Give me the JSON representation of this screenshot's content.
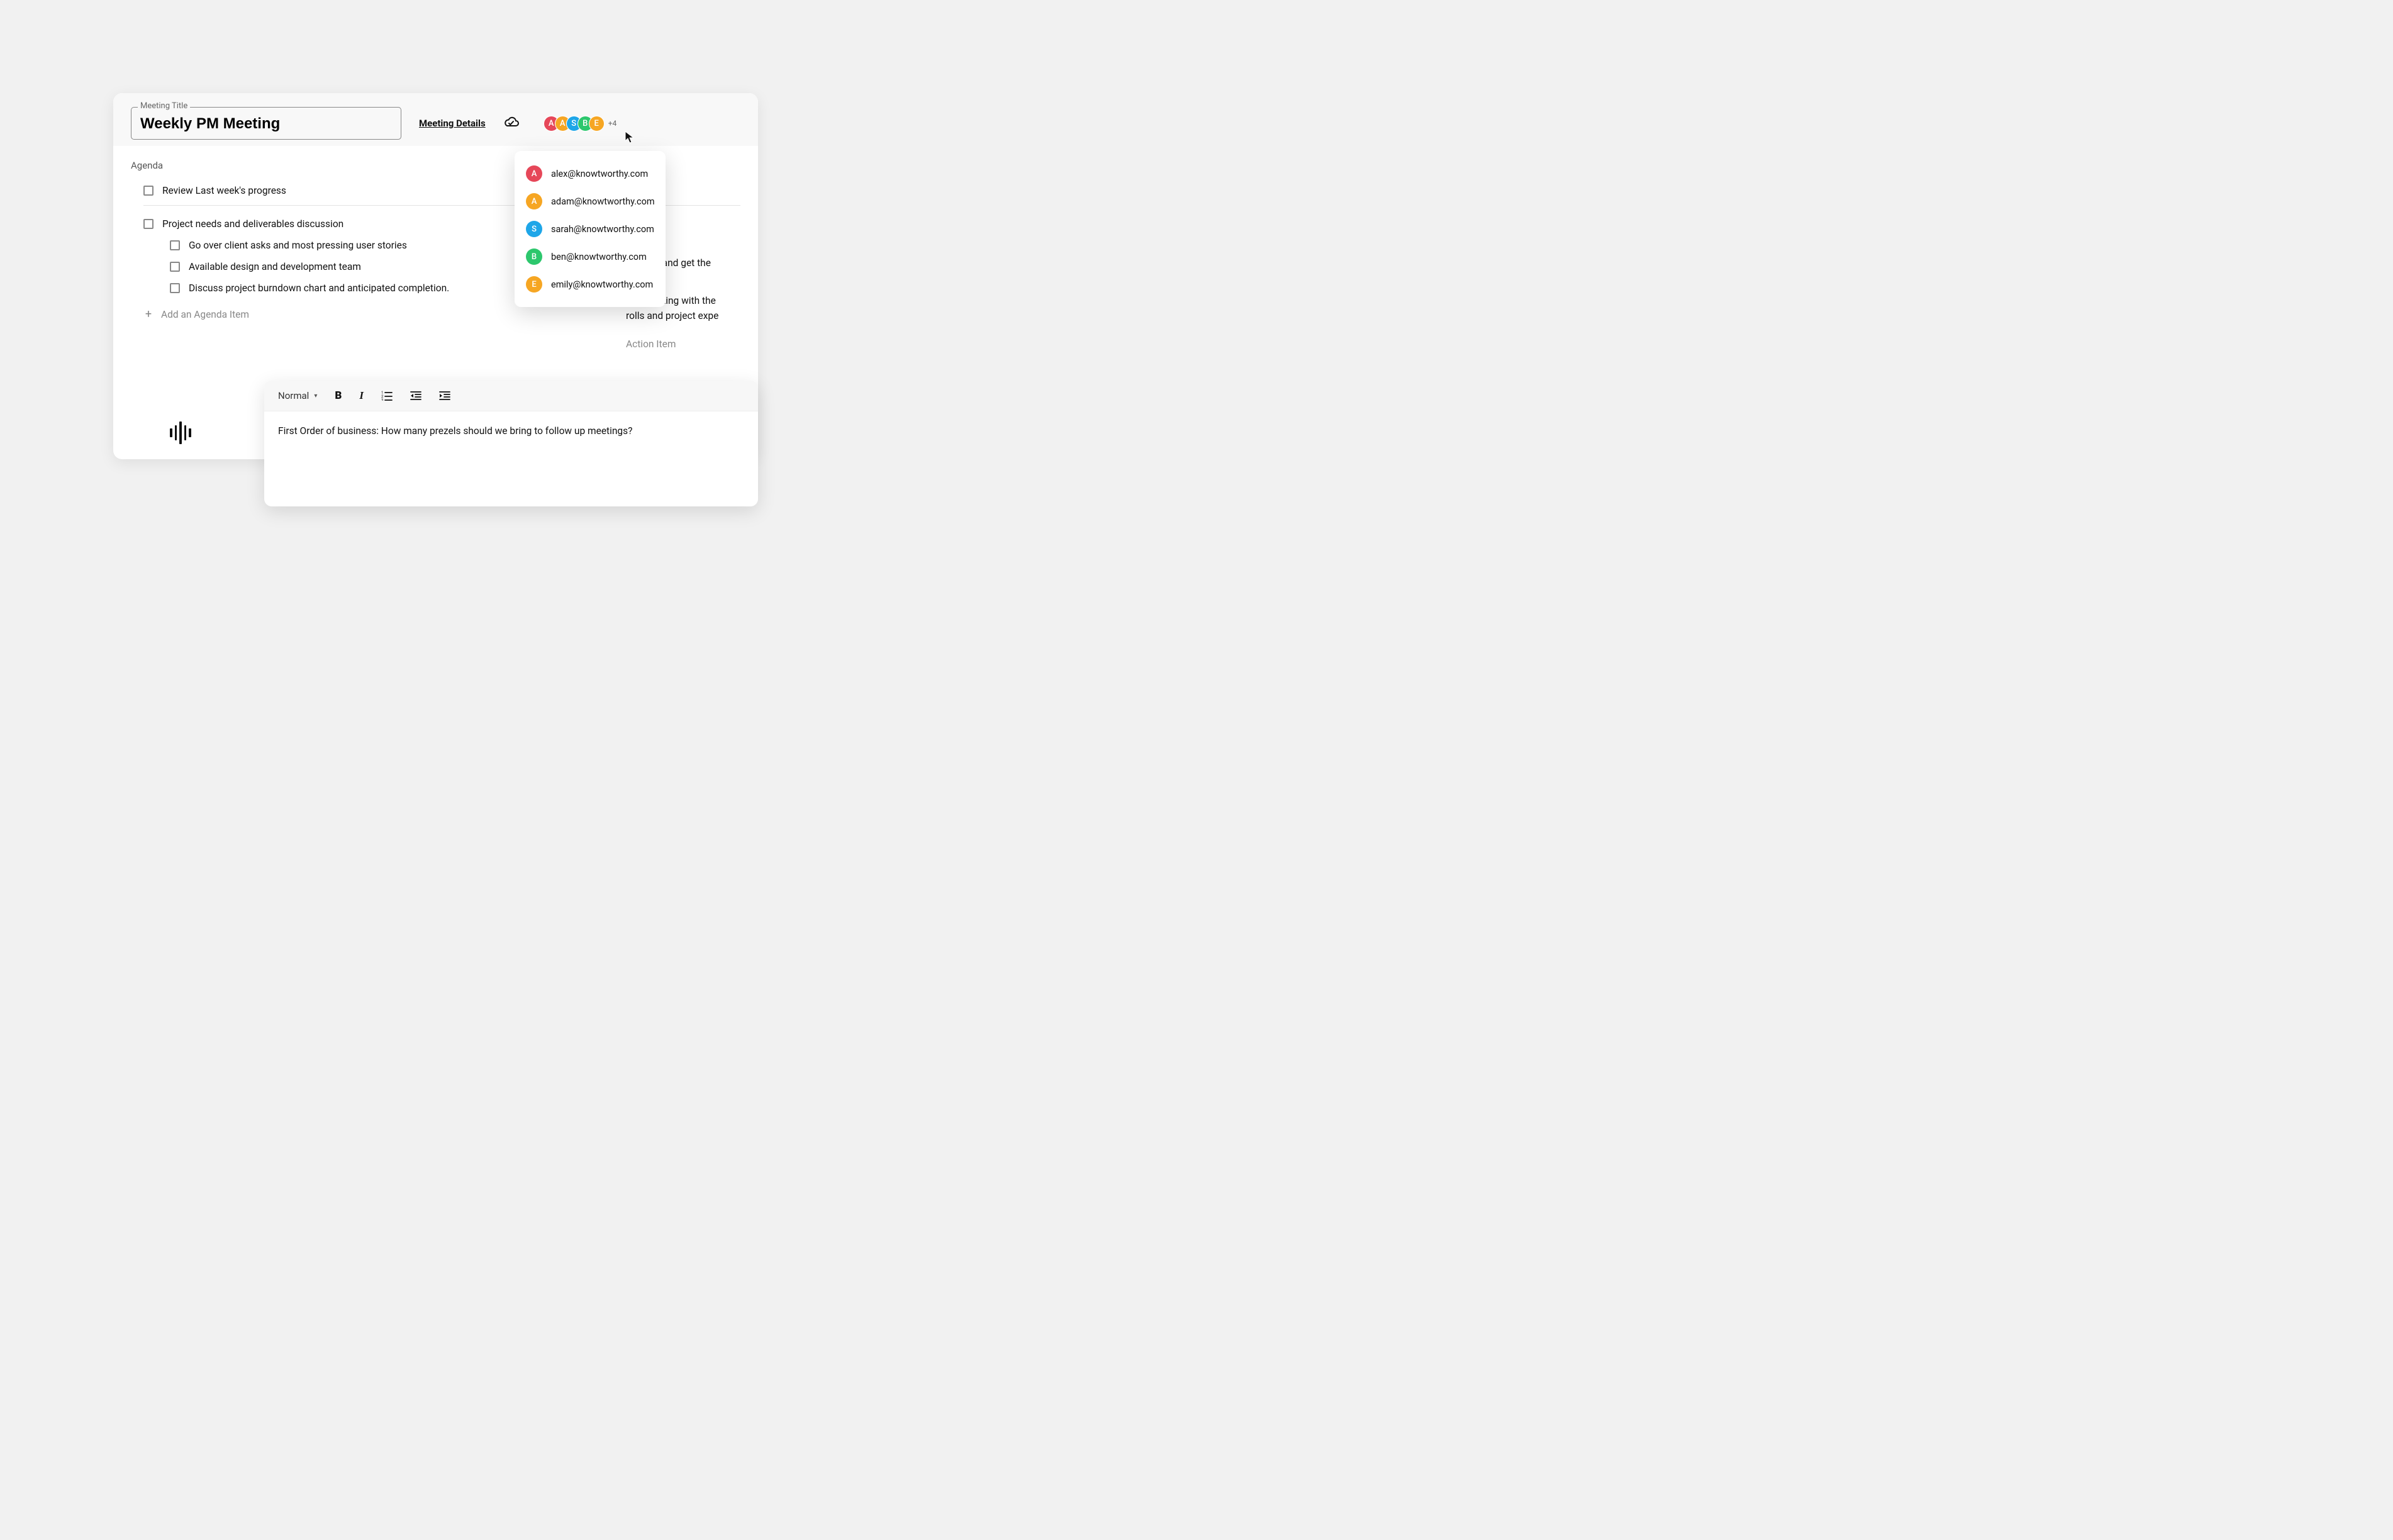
{
  "header": {
    "title_label": "Meeting Title",
    "title_value": "Weekly PM Meeting",
    "details_link": "Meeting Details"
  },
  "attendees": {
    "stack": [
      {
        "initial": "A",
        "color": "#e64759"
      },
      {
        "initial": "A",
        "color": "#f6a623"
      },
      {
        "initial": "S",
        "color": "#1ea6e8"
      },
      {
        "initial": "B",
        "color": "#2dc76d"
      },
      {
        "initial": "E",
        "color": "#f6a623"
      }
    ],
    "overflow": "+4",
    "list": [
      {
        "initial": "A",
        "color": "#e64759",
        "email": "alex@knowtworthy.com"
      },
      {
        "initial": "A",
        "color": "#f6a623",
        "email": "adam@knowtworthy.com"
      },
      {
        "initial": "S",
        "color": "#1ea6e8",
        "email": "sarah@knowtworthy.com"
      },
      {
        "initial": "B",
        "color": "#2dc76d",
        "email": "ben@knowtworthy.com"
      },
      {
        "initial": "E",
        "color": "#f6a623",
        "email": "emily@knowtworthy.com"
      }
    ]
  },
  "agenda": {
    "heading": "Agenda",
    "items": [
      {
        "text": "Review Last week's progress",
        "sub": false
      },
      {
        "text": "Project needs and deliverables discussion",
        "sub": false
      },
      {
        "text": "Go over client asks and most pressing user stories",
        "sub": true
      },
      {
        "text": "Available design and development team",
        "sub": true
      },
      {
        "text": "Discuss project burndown chart and anticipated completion.",
        "sub": true
      }
    ],
    "add_label": "Add an Agenda Item"
  },
  "action_items_peek": {
    "line1": "with Bill and get the",
    "line2a": "le a meeting with the",
    "line2b": "rolls and project expe",
    "add_label": "Action Item"
  },
  "editor": {
    "style_label": "Normal",
    "body_text": "First Order of business: How many prezels should we bring to follow up meetings?"
  }
}
